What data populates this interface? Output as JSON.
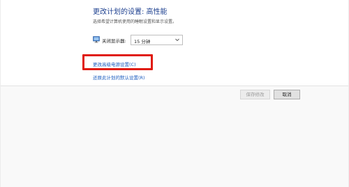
{
  "header": {
    "title": "更改计划的设置: 高性能",
    "subtitle": "选择希望计算机使用的睡眠设置和显示设置。"
  },
  "settings": {
    "display_off_label": "关闭显示器:",
    "display_off_value": "15 分钟",
    "icon": "monitor-power-icon"
  },
  "links": {
    "advanced": "更改高级电源设置(C)",
    "restore": "还原此计划的默认设置(R)"
  },
  "buttons": {
    "save": "保存修改",
    "cancel": "取消"
  },
  "colors": {
    "title": "#1c3f8f",
    "link": "#1a5bbf",
    "highlight": "#e01b10"
  }
}
